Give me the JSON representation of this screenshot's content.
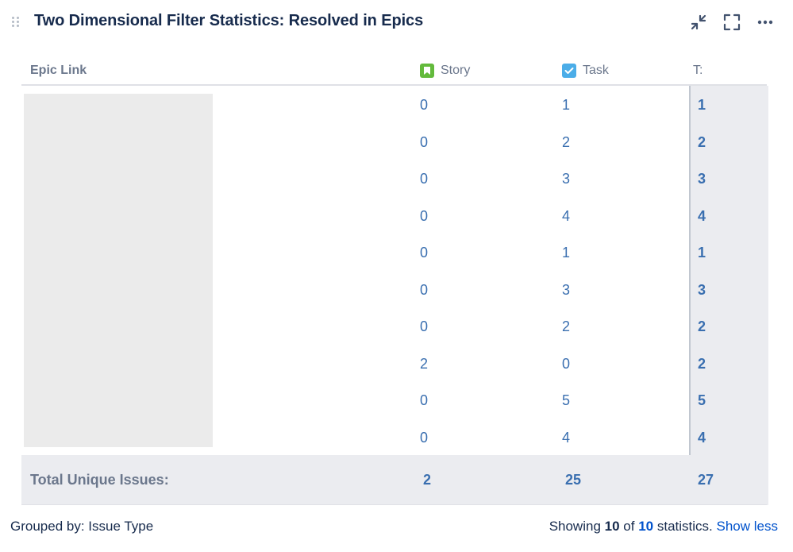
{
  "header": {
    "title": "Two Dimensional Filter Statistics: Resolved in Epics",
    "actions": [
      {
        "icon": "minimize-icon"
      },
      {
        "icon": "fullscreen-icon"
      },
      {
        "icon": "more-icon"
      }
    ]
  },
  "table": {
    "columns": {
      "epic": "Epic Link",
      "story": "Story",
      "task": "Task",
      "total": "T:"
    },
    "rows": [
      {
        "story": "0",
        "task": "1",
        "total": "1"
      },
      {
        "story": "0",
        "task": "2",
        "total": "2"
      },
      {
        "story": "0",
        "task": "3",
        "total": "3"
      },
      {
        "story": "0",
        "task": "4",
        "total": "4"
      },
      {
        "story": "0",
        "task": "1",
        "total": "1"
      },
      {
        "story": "0",
        "task": "3",
        "total": "3"
      },
      {
        "story": "0",
        "task": "2",
        "total": "2"
      },
      {
        "story": "2",
        "task": "0",
        "total": "2"
      },
      {
        "story": "0",
        "task": "5",
        "total": "5"
      },
      {
        "story": "0",
        "task": "4",
        "total": "4"
      }
    ],
    "footer": {
      "label": "Total Unique Issues:",
      "story": "2",
      "task": "25",
      "total": "27"
    }
  },
  "footer": {
    "grouped_by": "Grouped by: Issue Type",
    "showing_prefix": "Showing",
    "shown_count": "10",
    "of": "of",
    "total_count": "10",
    "suffix": "statistics.",
    "show_less": "Show less"
  },
  "colors": {
    "link": "#3a6fb0",
    "story_icon": "#63ba3c",
    "task_icon": "#4bade8",
    "header_text": "#6b778c",
    "total_bg": "#ebecf0"
  }
}
